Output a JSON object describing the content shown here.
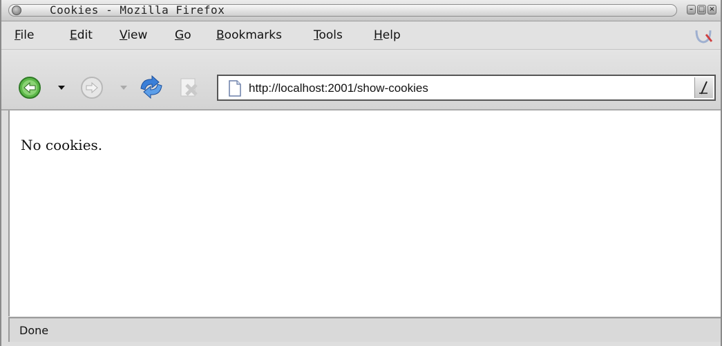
{
  "window": {
    "title": "Cookies - Mozilla Firefox",
    "buttons": [
      "minimize",
      "maximize",
      "close"
    ]
  },
  "menubar": {
    "items": [
      {
        "label_u": "F",
        "label_rest": "ile"
      },
      {
        "label_u": "E",
        "label_rest": "dit"
      },
      {
        "label_u": "V",
        "label_rest": "iew"
      },
      {
        "label_u": "G",
        "label_rest": "o"
      },
      {
        "label_u": "B",
        "label_rest": "ookmarks"
      },
      {
        "label_u": "T",
        "label_rest": "ools"
      },
      {
        "label_u": "H",
        "label_rest": "elp"
      }
    ]
  },
  "navbar": {
    "url": "http://localhost:2001/show-cookies",
    "icons": [
      "back-arrow-icon",
      "back-dropdown-icon",
      "forward-arrow-icon",
      "forward-dropdown-icon",
      "reload-icon",
      "stop-icon",
      "page-document-icon",
      "url-dropdown-icon"
    ]
  },
  "content": {
    "text": "No cookies."
  },
  "status": {
    "text": "Done"
  },
  "colors": {
    "back_button": "#4caf3a",
    "chrome_bg": "#dedede",
    "content_bg": "#ffffff"
  }
}
